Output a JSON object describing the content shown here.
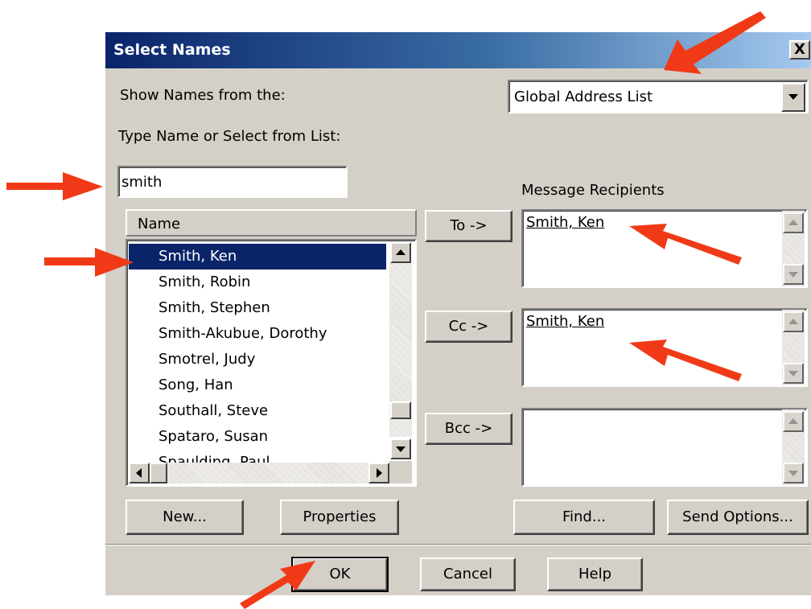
{
  "dialog": {
    "title": "Select Names",
    "close_label": "X",
    "show_names_label": "Show Names from the:",
    "address_book": "Global Address List",
    "type_name_label": "Type Name or Select from List:",
    "search_value": "smith",
    "name_column_header": "Name",
    "names_list": [
      "Smith, Ken",
      "Smith, Robin",
      "Smith, Stephen",
      "Smith-Akubue, Dorothy",
      "Smotrel, Judy",
      "Song, Han",
      "Southall, Steve",
      "Spataro, Susan",
      "Spaulding, Paul"
    ],
    "selected_name": "Smith, Ken",
    "message_recipients_label": "Message Recipients",
    "to_button": "To ->",
    "cc_button": "Cc ->",
    "bcc_button": "Bcc ->",
    "to_recipient": "Smith, Ken",
    "cc_recipient": "Smith, Ken",
    "new_button": "New...",
    "properties_button": "Properties",
    "find_button": "Find...",
    "send_options_button": "Send Options...",
    "ok_button": "OK",
    "cancel_button": "Cancel",
    "help_button": "Help"
  },
  "colors": {
    "title_bar": "#0a246a",
    "selection": "#0a246a",
    "dialog_face": "#d4d0c8",
    "annotation_arrow": "#f03a17"
  },
  "annotations": {
    "arrow_count": 6,
    "arrow_icon": "red-arrow-icon"
  }
}
